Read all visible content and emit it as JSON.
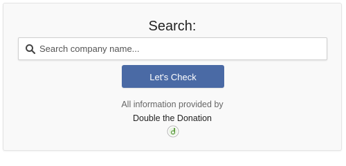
{
  "search": {
    "title": "Search:",
    "placeholder": "Search company name...",
    "value": "",
    "button_label": "Let's Check"
  },
  "attribution": {
    "text": "All information provided by",
    "provider": "Double the Donation",
    "logo_icon": "double-the-donation-logo"
  },
  "colors": {
    "button": "#4a6aa5",
    "logo_green": "#5a9a3c"
  }
}
